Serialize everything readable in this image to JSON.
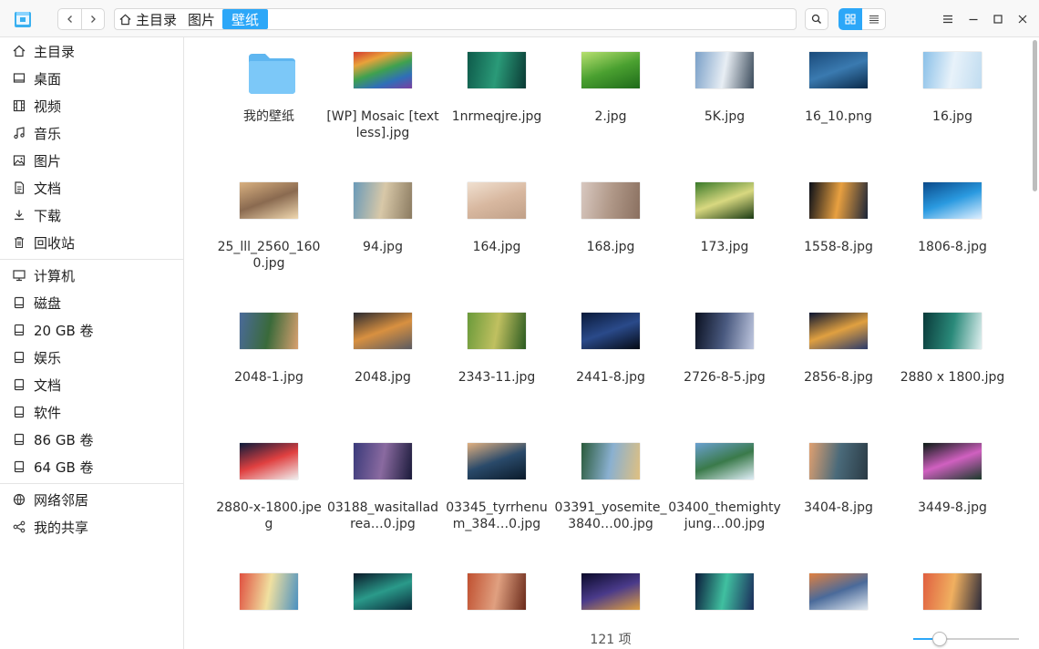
{
  "breadcrumb": {
    "home": "主目录",
    "parent": "图片",
    "current": "壁纸"
  },
  "colors": {
    "accent": "#2ca7f8",
    "folder": "#7cc8f8"
  },
  "sidebar": {
    "items": [
      {
        "label": "主目录",
        "icon": "home-icon"
      },
      {
        "label": "桌面",
        "icon": "desktop-icon"
      },
      {
        "label": "视频",
        "icon": "video-icon"
      },
      {
        "label": "音乐",
        "icon": "music-icon"
      },
      {
        "label": "图片",
        "icon": "picture-icon"
      },
      {
        "label": "文档",
        "icon": "document-icon"
      },
      {
        "label": "下载",
        "icon": "download-icon"
      },
      {
        "label": "回收站",
        "icon": "trash-icon"
      },
      {
        "label": "计算机",
        "icon": "computer-icon"
      },
      {
        "label": "磁盘",
        "icon": "disk-icon"
      },
      {
        "label": "20 GB 卷",
        "icon": "disk-icon"
      },
      {
        "label": "娱乐",
        "icon": "disk-icon"
      },
      {
        "label": "文档",
        "icon": "disk-icon"
      },
      {
        "label": "软件",
        "icon": "disk-icon"
      },
      {
        "label": "86 GB 卷",
        "icon": "disk-icon"
      },
      {
        "label": "64 GB 卷",
        "icon": "disk-icon"
      },
      {
        "label": "网络邻居",
        "icon": "network-icon"
      },
      {
        "label": "我的共享",
        "icon": "share-icon"
      }
    ]
  },
  "files": [
    {
      "name": "我的壁纸",
      "kind": "folder"
    },
    {
      "name": "[WP] Mosaic [textless].jpg",
      "colors": [
        "#d43a2f",
        "#e8a23a",
        "#3fa14f",
        "#2f6fb8",
        "#7a3fa0"
      ]
    },
    {
      "name": "1nrmeqjre.jpg",
      "colors": [
        "#0e5a4a",
        "#2a9a78",
        "#0a3a34"
      ]
    },
    {
      "name": "2.jpg",
      "colors": [
        "#b8e070",
        "#4aa030",
        "#1e6a1a"
      ]
    },
    {
      "name": "5K.jpg",
      "colors": [
        "#7aa0c8",
        "#e8eef4",
        "#3a4a5a"
      ]
    },
    {
      "name": "16_10.png",
      "colors": [
        "#1a4a7a",
        "#3a7ab0",
        "#0a2a4a"
      ]
    },
    {
      "name": "16.jpg",
      "colors": [
        "#8ac0e8",
        "#e8f2fa",
        "#c0dcf0"
      ]
    },
    {
      "name": "25_lll_2560_1600.jpg",
      "colors": [
        "#d8b080",
        "#8a6a50",
        "#f0d8b0"
      ]
    },
    {
      "name": "94.jpg",
      "colors": [
        "#6a9ab8",
        "#d8c8a8",
        "#8a7a60"
      ]
    },
    {
      "name": "164.jpg",
      "colors": [
        "#f0e0d0",
        "#d8b8a0",
        "#c0a088"
      ]
    },
    {
      "name": "168.jpg",
      "colors": [
        "#d8c8c0",
        "#b09888",
        "#8a7060"
      ]
    },
    {
      "name": "173.jpg",
      "colors": [
        "#3a7a2a",
        "#d8d880",
        "#1a3a14"
      ]
    },
    {
      "name": "1558-8.jpg",
      "colors": [
        "#0a0e18",
        "#e8a040",
        "#1a2438"
      ]
    },
    {
      "name": "1806-8.jpg",
      "colors": [
        "#0a4a8a",
        "#2a9ae0",
        "#e0f0ff"
      ]
    },
    {
      "name": "2048-1.jpg",
      "colors": [
        "#4a6a9a",
        "#3a6a3a",
        "#d8a070"
      ]
    },
    {
      "name": "2048.jpg",
      "colors": [
        "#2a2a30",
        "#d89040",
        "#5a5a60"
      ]
    },
    {
      "name": "2343-11.jpg",
      "colors": [
        "#6a9a3a",
        "#c0c060",
        "#2a5a20"
      ]
    },
    {
      "name": "2441-8.jpg",
      "colors": [
        "#0a1a3a",
        "#2a4a8a",
        "#050a14"
      ]
    },
    {
      "name": "2726-8-5.jpg",
      "colors": [
        "#0a1020",
        "#4a5a80",
        "#c0c8e0"
      ]
    },
    {
      "name": "2856-8.jpg",
      "colors": [
        "#0a1430",
        "#e0a040",
        "#2a3a6a"
      ]
    },
    {
      "name": "2880 x 1800.jpg",
      "colors": [
        "#0a3a3a",
        "#2a8a7a",
        "#e0f0f0"
      ]
    },
    {
      "name": "2880-x-1800.jpeg",
      "colors": [
        "#0a1a3a",
        "#e04040",
        "#f0f0f0"
      ]
    },
    {
      "name": "03188_wasitalladrea…0.jpg",
      "colors": [
        "#3a3a7a",
        "#8a6aa0",
        "#1a1a3a"
      ]
    },
    {
      "name": "03345_tyrrhenum_384…0.jpg",
      "colors": [
        "#e0b080",
        "#2a4a6a",
        "#0a1a2a"
      ]
    },
    {
      "name": "03391_yosemite_3840…00.jpg",
      "colors": [
        "#2a5a3a",
        "#8ab0d0",
        "#e0c080"
      ]
    },
    {
      "name": "03400_themightyjung…00.jpg",
      "colors": [
        "#6aa0d0",
        "#3a7a4a",
        "#e0eef8"
      ]
    },
    {
      "name": "3404-8.jpg",
      "colors": [
        "#e0a070",
        "#4a6a7a",
        "#2a3a44"
      ]
    },
    {
      "name": "3449-8.jpg",
      "colors": [
        "#0a1a14",
        "#d060c0",
        "#1a3a2a"
      ]
    },
    {
      "name": "",
      "colors": [
        "#e05040",
        "#f0e0a0",
        "#4a90c0"
      ]
    },
    {
      "name": "",
      "colors": [
        "#0a1a2a",
        "#2a9a8a",
        "#0a2a3a"
      ]
    },
    {
      "name": "",
      "colors": [
        "#c05030",
        "#e0a080",
        "#6a2a1a"
      ]
    },
    {
      "name": "",
      "colors": [
        "#0a0a2a",
        "#4a3a8a",
        "#e0a040"
      ]
    },
    {
      "name": "",
      "colors": [
        "#0a1a3a",
        "#40c0a0",
        "#1a2a5a"
      ]
    },
    {
      "name": "",
      "colors": [
        "#e08040",
        "#4a6a9a",
        "#e0e8f0"
      ]
    },
    {
      "name": "",
      "colors": [
        "#e06040",
        "#f0b060",
        "#2a2a3a"
      ]
    }
  ],
  "status": {
    "count": "121 项"
  },
  "zoom": {
    "level": 0.25
  }
}
